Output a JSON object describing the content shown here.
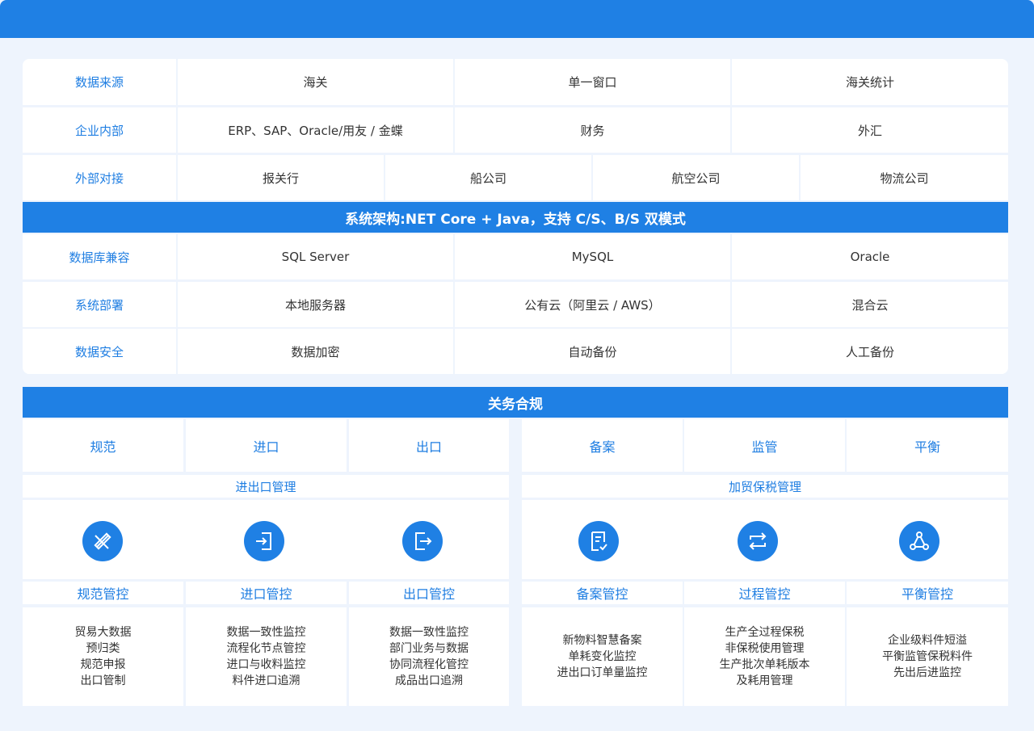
{
  "rows_top": [
    {
      "label": "数据来源",
      "cells": [
        "海关",
        "单一窗口",
        "海关统计"
      ]
    },
    {
      "label": "企业内部",
      "cells": [
        "ERP、SAP、Oracle/用友 / 金蝶",
        "财务",
        "外汇"
      ]
    },
    {
      "label": "外部对接",
      "cells": [
        "报关行",
        "船公司",
        "航空公司",
        "物流公司"
      ]
    }
  ],
  "arch_banner": "系统架构:NET Core + Java，支持 C/S、B/S 双模式",
  "rows_bottom": [
    {
      "label": "数据库兼容",
      "cells": [
        "SQL Server",
        "MySQL",
        "Oracle"
      ]
    },
    {
      "label": "系统部署",
      "cells": [
        "本地服务器",
        "公有云（阿里云 / AWS）",
        "混合云"
      ]
    },
    {
      "label": "数据安全",
      "cells": [
        "数据加密",
        "自动备份",
        "人工备份"
      ]
    }
  ],
  "compliance_banner": "关务合规",
  "categories": [
    "规范",
    "进口",
    "出口",
    "备案",
    "监管",
    "平衡"
  ],
  "groups": [
    "进出口管理",
    "加贸保税管理"
  ],
  "controls": [
    {
      "title": "规范管控",
      "icon": "pencil-ruler-icon",
      "lines": [
        "贸易大数据",
        "预归类",
        "规范申报",
        "出口管制"
      ]
    },
    {
      "title": "进口管控",
      "icon": "import-icon",
      "lines": [
        "数据一致性监控",
        "流程化节点管控",
        "进口与收料监控",
        "料件进口追溯"
      ]
    },
    {
      "title": "出口管控",
      "icon": "export-icon",
      "lines": [
        "数据一致性监控",
        "部门业务与数据",
        "协同流程化管控",
        "成品出口追溯"
      ]
    },
    {
      "title": "备案管控",
      "icon": "document-check-icon",
      "lines": [
        "新物料智慧备案",
        "单耗变化监控",
        "进出口订单量监控"
      ]
    },
    {
      "title": "过程管控",
      "icon": "cycle-arrows-icon",
      "lines": [
        "生产全过程保税",
        "非保税使用管理",
        "生产批次单耗版本",
        "及耗用管理"
      ]
    },
    {
      "title": "平衡管控",
      "icon": "network-triangle-icon",
      "lines": [
        "企业级料件短溢",
        "平衡监管保税料件",
        "先出后进监控"
      ]
    }
  ]
}
